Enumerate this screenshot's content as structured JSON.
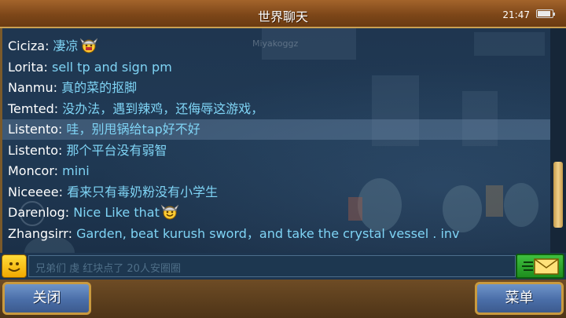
{
  "header": {
    "title": "世界聊天",
    "time": "21:47",
    "battery_level": 0.9
  },
  "watermark": "Miyakoggz",
  "messages": [
    {
      "name": "Ciciza",
      "text": "凄凉",
      "emoji": "viking-face-icon",
      "highlight": false
    },
    {
      "name": "Lorita",
      "text": "sell tp and sign pm",
      "emoji": "",
      "highlight": false
    },
    {
      "name": "Nanmu",
      "text": "真的菜的抠脚",
      "emoji": "",
      "highlight": false
    },
    {
      "name": "Temted",
      "text": "没办法，遇到辣鸡，还侮辱这游戏，",
      "emoji": "",
      "highlight": false
    },
    {
      "name": "Listento",
      "text": "哇，别甩锅给tap好不好",
      "emoji": "",
      "highlight": true
    },
    {
      "name": "Listento",
      "text": "那个平台没有弱智",
      "emoji": "",
      "highlight": false
    },
    {
      "name": "Moncor",
      "text": "mini",
      "emoji": "",
      "highlight": false
    },
    {
      "name": "Niceeee",
      "text": "看来只有毒奶粉没有小学生",
      "emoji": "",
      "highlight": false
    },
    {
      "name": "Darenlog",
      "text": "Nice Like that",
      "emoji": "viking-smile-icon",
      "highlight": false
    },
    {
      "name": "Zhangsirr",
      "text": "Garden, beat kurush sword，and take the crystal vessel . inv",
      "emoji": "",
      "highlight": false
    }
  ],
  "input": {
    "placeholder": "兄弟们 虔 红块点了 20人安圈圈"
  },
  "buttons": {
    "close": "关闭",
    "menu": "菜单"
  },
  "colors": {
    "name": "#ffffff",
    "message_text": "#7fd4f5",
    "title_bar": "#7d4719",
    "button": "#4a6ea8"
  }
}
